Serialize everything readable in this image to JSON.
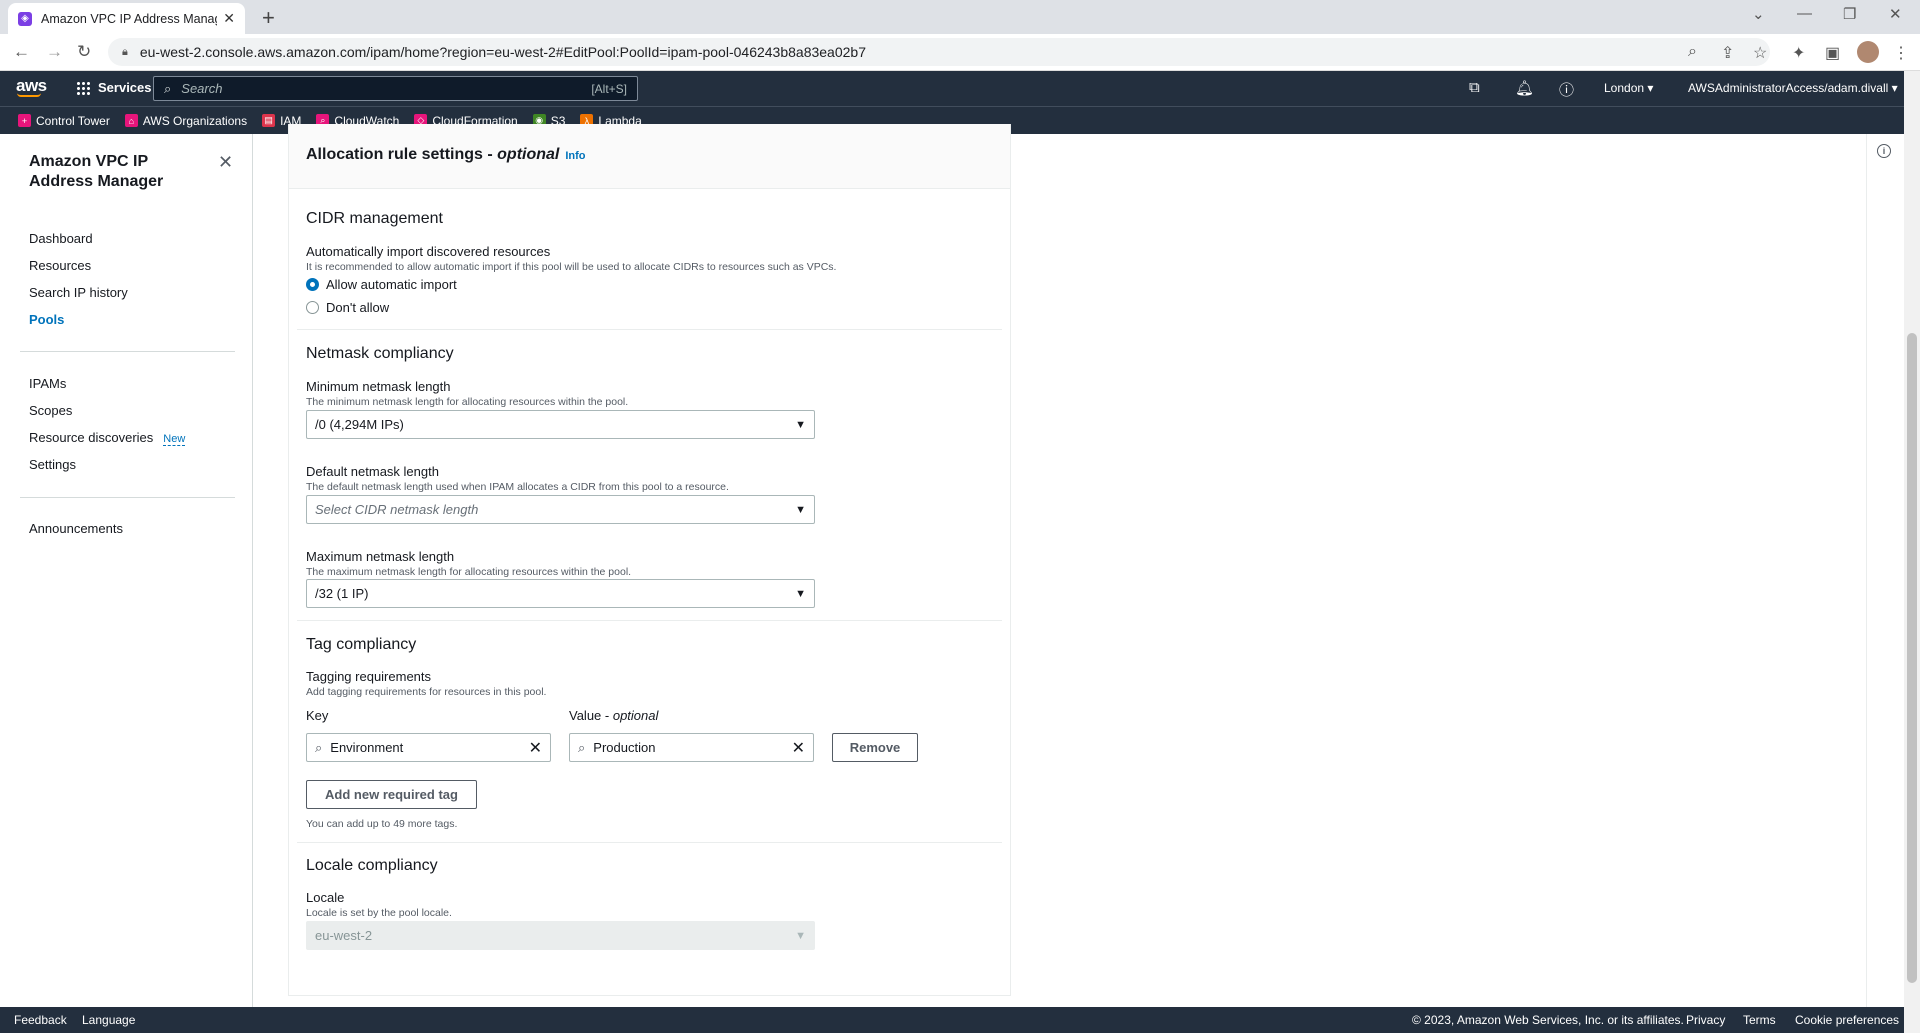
{
  "browser": {
    "tab_title": "Amazon VPC IP Address Manage",
    "url": "eu-west-2.console.aws.amazon.com/ipam/home?region=eu-west-2#EditPool:PoolId=ipam-pool-046243b8a83ea02b7"
  },
  "aws_header": {
    "logo": "aws",
    "services_label": "Services",
    "search_placeholder": "Search",
    "search_hint": "[Alt+S]",
    "region": "London ▾",
    "account": "AWSAdministratorAccess/adam.divall ▾"
  },
  "favorites": [
    {
      "label": "Control Tower",
      "color": "#e7157b"
    },
    {
      "label": "AWS Organizations",
      "color": "#e7157b"
    },
    {
      "label": "IAM",
      "color": "#dd344c"
    },
    {
      "label": "CloudWatch",
      "color": "#e7157b"
    },
    {
      "label": "CloudFormation",
      "color": "#e7157b"
    },
    {
      "label": "S3",
      "color": "#3f8624"
    },
    {
      "label": "Lambda",
      "color": "#ed7100"
    }
  ],
  "sidebar": {
    "title": "Amazon VPC IP Address Manager",
    "items": [
      {
        "label": "Dashboard"
      },
      {
        "label": "Resources"
      },
      {
        "label": "Search IP history"
      },
      {
        "label": "Pools"
      },
      {
        "label": "IPAMs"
      },
      {
        "label": "Scopes"
      },
      {
        "label": "Resource discoveries",
        "badge": "New"
      },
      {
        "label": "Settings"
      },
      {
        "label": "Announcements"
      }
    ]
  },
  "panel": {
    "title": "Allocation rule settings - ",
    "title_optional": "optional",
    "info": "Info",
    "cidr": {
      "heading": "CIDR management",
      "label": "Automatically import discovered resources",
      "desc": "It is recommended to allow automatic import if this pool will be used to allocate CIDRs to resources such as VPCs.",
      "option_allow": "Allow automatic import",
      "option_deny": "Don't allow",
      "selected": "Allow automatic import"
    },
    "netmask": {
      "heading": "Netmask compliancy",
      "min_label": "Minimum netmask length",
      "min_desc": "The minimum netmask length for allocating resources within the pool.",
      "min_value": "/0 (4,294M IPs)",
      "default_label": "Default netmask length",
      "default_desc": "The default netmask length used when IPAM allocates a CIDR from this pool to a resource.",
      "default_placeholder": "Select CIDR netmask length",
      "max_label": "Maximum netmask length",
      "max_desc": "The maximum netmask length for allocating resources within the pool.",
      "max_value": "/32 (1 IP)"
    },
    "tags": {
      "heading": "Tag compliancy",
      "label": "Tagging requirements",
      "desc": "Add tagging requirements for resources in this pool.",
      "key_label": "Key",
      "value_label": "Value - ",
      "value_optional": "optional",
      "key_value": "Environment",
      "value_value": "Production",
      "remove": "Remove",
      "add": "Add new required tag",
      "limit": "You can add up to 49 more tags."
    },
    "locale": {
      "heading": "Locale compliancy",
      "label": "Locale",
      "desc": "Locale is set by the pool locale.",
      "value": "eu-west-2"
    }
  },
  "footer": {
    "feedback": "Feedback",
    "language": "Language",
    "copyright": "© 2023, Amazon Web Services, Inc. or its affiliates.",
    "privacy": "Privacy",
    "terms": "Terms",
    "cookies": "Cookie preferences"
  }
}
